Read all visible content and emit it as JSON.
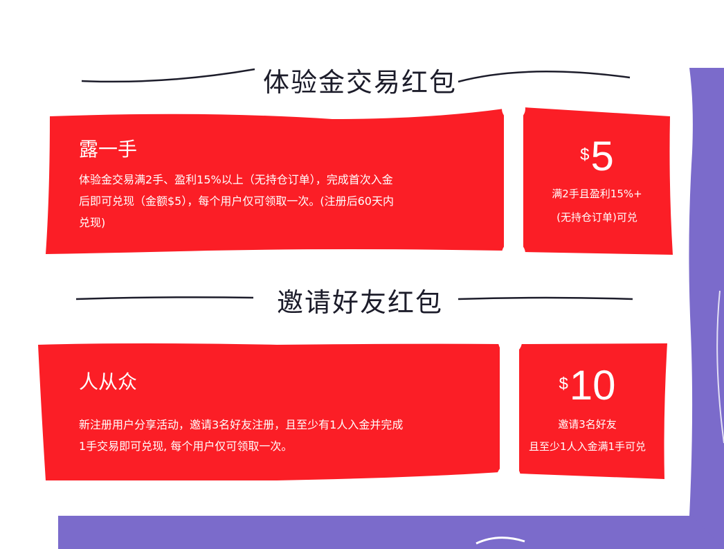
{
  "section_trial": {
    "title": "体验金交易红包",
    "card": {
      "heading": "露一手",
      "desc_line1": "体验金交易满2手、盈利15%以上（无持仓订单），完成首次入金",
      "desc_line2": "后即可兑现（金额$5），每个用户仅可领取一次。(注册后60天内",
      "desc_line3": "兑现)",
      "currency": "$",
      "amount": "5",
      "cond_line1": "满2手且盈利15%+",
      "cond_line2": "(无持仓订单)可兑"
    }
  },
  "section_invite": {
    "title": "邀请好友红包",
    "card": {
      "heading": "人从众",
      "desc_line1": "新注册用户分享活动，邀请3名好友注册，且至少有1人入金并完成",
      "desc_line2": "1手交易即可兑现, 每个用户仅可领取一次。",
      "currency": "$",
      "amount": "10",
      "cond_line1": "邀请3名好友",
      "cond_line2": "且至少1人入金满1手可兑"
    }
  },
  "colors": {
    "card_red": "#fb1e26",
    "purple": "#7b6bcb",
    "title_text": "#1c1c2a"
  }
}
